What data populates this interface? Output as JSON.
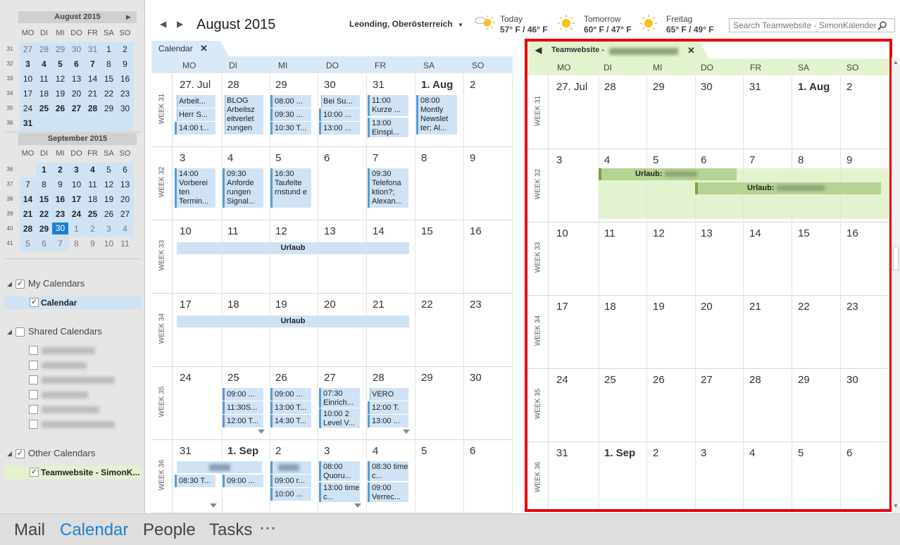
{
  "sidebar": {
    "mini_aug": {
      "title": "August 2015",
      "dow": [
        "MO",
        "DI",
        "MI",
        "DO",
        "FR",
        "SA",
        "SO"
      ],
      "weeks": [
        {
          "wk": "31",
          "days": [
            "27",
            "28",
            "29",
            "30",
            "31",
            "1",
            "2"
          ]
        },
        {
          "wk": "32",
          "days": [
            "3",
            "4",
            "5",
            "6",
            "7",
            "8",
            "9"
          ]
        },
        {
          "wk": "33",
          "days": [
            "10",
            "11",
            "12",
            "13",
            "14",
            "15",
            "16"
          ]
        },
        {
          "wk": "34",
          "days": [
            "17",
            "18",
            "19",
            "20",
            "21",
            "22",
            "23"
          ]
        },
        {
          "wk": "35",
          "days": [
            "24",
            "25",
            "26",
            "27",
            "28",
            "29",
            "30"
          ]
        },
        {
          "wk": "36",
          "days": [
            "31"
          ]
        }
      ]
    },
    "mini_sep": {
      "title": "September 2015",
      "dow": [
        "MO",
        "DI",
        "MI",
        "DO",
        "FR",
        "SA",
        "SO"
      ],
      "weeks": [
        {
          "wk": "36",
          "days": [
            "",
            "1",
            "2",
            "3",
            "4",
            "5",
            "6"
          ]
        },
        {
          "wk": "37",
          "days": [
            "7",
            "8",
            "9",
            "10",
            "11",
            "12",
            "13"
          ]
        },
        {
          "wk": "38",
          "days": [
            "14",
            "15",
            "16",
            "17",
            "18",
            "19",
            "20"
          ]
        },
        {
          "wk": "39",
          "days": [
            "21",
            "22",
            "23",
            "24",
            "25",
            "26",
            "27"
          ]
        },
        {
          "wk": "40",
          "days": [
            "28",
            "29",
            "30",
            "1",
            "2",
            "3",
            "4"
          ]
        },
        {
          "wk": "41",
          "days": [
            "5",
            "6",
            "7",
            "8",
            "9",
            "10",
            "11"
          ]
        }
      ]
    },
    "my_calendars": "My Calendars",
    "calendar_item": "Calendar",
    "shared_calendars": "Shared Calendars",
    "other_calendars": "Other Calendars",
    "teamwebsite_item": "Teamwebsite - SimonK...",
    "check": "✓"
  },
  "bottomnav": {
    "mail": "Mail",
    "calendar": "Calendar",
    "people": "People",
    "tasks": "Tasks",
    "more": "···"
  },
  "header": {
    "title": "August 2015",
    "location": "Leonding, Oberösterreich",
    "weather": [
      {
        "label": "Today",
        "temp": "57° F / 46° F",
        "icon": "partly-cloudy-icon"
      },
      {
        "label": "Tomorrow",
        "temp": "60° F / 47° F",
        "icon": "sun-icon"
      },
      {
        "label": "Freitag",
        "temp": "65° F / 49° F",
        "icon": "sun-icon"
      }
    ],
    "search_placeholder": "Search Teamwebsite - SimonKalender..."
  },
  "left_cal": {
    "tab": "Calendar",
    "dow": [
      "MO",
      "DI",
      "MI",
      "DO",
      "FR",
      "SA",
      "SO"
    ],
    "weeks": [
      {
        "label": "WEEK 31",
        "days": [
          "27. Jul",
          "28",
          "29",
          "30",
          "31",
          "1. Aug",
          "2"
        ]
      },
      {
        "label": "WEEK 32",
        "days": [
          "3",
          "4",
          "5",
          "6",
          "7",
          "8",
          "9"
        ]
      },
      {
        "label": "WEEK 33",
        "days": [
          "10",
          "11",
          "12",
          "13",
          "14",
          "15",
          "16"
        ]
      },
      {
        "label": "WEEK 34",
        "days": [
          "17",
          "18",
          "19",
          "20",
          "21",
          "22",
          "23"
        ]
      },
      {
        "label": "WEEK 35",
        "days": [
          "24",
          "25",
          "26",
          "27",
          "28",
          "29",
          "30"
        ]
      },
      {
        "label": "WEEK 36",
        "days": [
          "31",
          "1. Sep",
          "2",
          "3",
          "4",
          "5",
          "6"
        ]
      }
    ],
    "events": {
      "w31": [
        [
          "Arbeit...",
          "Herr S...",
          "14:00 t..."
        ],
        [
          "BLOG Arbeitsz eitverlet zungen"
        ],
        [
          "08:00 ...",
          "09:30 ...",
          "10:30 T..."
        ],
        [
          "Bei Su...",
          "10:00 ...",
          "13:00 ..."
        ],
        [
          "11:00 Kurze ...",
          "13:00 Einspi..."
        ],
        [
          "08:00 Montly Newslet ter; Al..."
        ]
      ],
      "w32": [
        "14:00 Vorberei ten Termin...",
        "09:30 Anforde rungen Signal...",
        "16:30 Taufelte rnstund e",
        "09:30 Telefona ktion?; Alexan..."
      ],
      "urlaub": "Urlaub",
      "w35": [
        [
          "09:00 ...",
          "11:30S...",
          "12:00 T..."
        ],
        [
          "09:00 ...",
          "13:00 T...",
          "14:30 T..."
        ],
        [
          "07:30 Einrich...",
          "10:00 2 Level V..."
        ],
        [
          "VERO",
          "12:00 T.",
          "13:00 ..."
        ]
      ],
      "w36": [
        [
          "08:30 T...",
          "09:00 ..."
        ],
        [
          "09:00 r...",
          "10:00 ..."
        ],
        [
          "08:00 Quoru...",
          "13:00 time c..."
        ],
        [
          "08:30 time c...",
          "09:00 Verrec..."
        ]
      ]
    }
  },
  "right_cal": {
    "tab": "Teamwebsite - ",
    "dow": [
      "MO",
      "DI",
      "MI",
      "DO",
      "FR",
      "SA",
      "SO"
    ],
    "weeks": [
      {
        "label": "WEEK 31",
        "days": [
          "27. Jul",
          "28",
          "29",
          "30",
          "31",
          "1. Aug",
          "2"
        ]
      },
      {
        "label": "WEEK 32",
        "days": [
          "3",
          "4",
          "5",
          "6",
          "7",
          "8",
          "9"
        ]
      },
      {
        "label": "WEEK 33",
        "days": [
          "10",
          "11",
          "12",
          "13",
          "14",
          "15",
          "16"
        ]
      },
      {
        "label": "WEEK 34",
        "days": [
          "17",
          "18",
          "19",
          "20",
          "21",
          "22",
          "23"
        ]
      },
      {
        "label": "WEEK 35",
        "days": [
          "24",
          "25",
          "26",
          "27",
          "28",
          "29",
          "30"
        ]
      },
      {
        "label": "WEEK 36",
        "days": [
          "31",
          "1. Sep",
          "2",
          "3",
          "4",
          "5",
          "6"
        ]
      }
    ],
    "urlaub1": "Urlaub: ",
    "urlaub2": "Urlaub: "
  },
  "colors": {
    "accent": "#1e7fd0",
    "event": "#cfe3f4",
    "green": "#e3f3cf",
    "highlight": "#e8000b"
  }
}
